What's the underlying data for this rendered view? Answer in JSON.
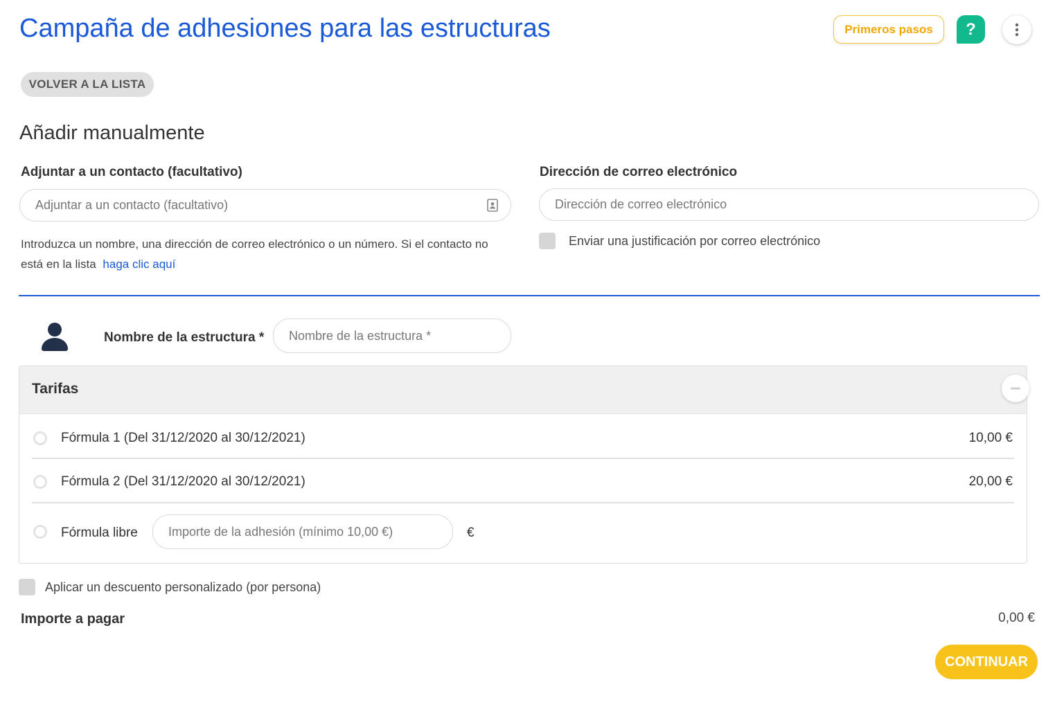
{
  "header": {
    "title": "Campaña de adhesiones para las estructuras",
    "first_steps_label": "Primeros pasos",
    "help_label": "?"
  },
  "back_button_label": "VOLVER A LA LISTA",
  "section_title": "Añadir manualmente",
  "contact": {
    "label": "Adjuntar a un contacto (facultativo)",
    "placeholder": "Adjuntar a un contacto (facultativo)",
    "value": "",
    "helper_text": "Introduzca un nombre, una dirección de correo electrónico o un número. Si el contacto no está en la lista",
    "helper_link": "haga clic aquí"
  },
  "email": {
    "label": "Dirección de correo electrónico",
    "placeholder": "Dirección de correo electrónico",
    "value": "",
    "send_receipt_label": "Enviar una justificación por correo electrónico",
    "send_receipt_checked": false
  },
  "structure": {
    "label": "Nombre de la estructura *",
    "placeholder": "Nombre de la estructura *",
    "value": ""
  },
  "tarifas": {
    "title": "Tarifas",
    "options": [
      {
        "label": "Fórmula 1 (Del 31/12/2020 al 30/12/2021)",
        "price": "10,00 €",
        "selected": false
      },
      {
        "label": "Fórmula 2 (Del 31/12/2020 al 30/12/2021)",
        "price": "20,00 €",
        "selected": false
      }
    ],
    "free": {
      "label": "Fórmula libre",
      "placeholder": "Importe de la adhesión (mínimo 10,00 €)",
      "value": "",
      "currency": "€",
      "selected": false
    }
  },
  "discount": {
    "label": "Aplicar un descuento personalizado (por persona)",
    "checked": false
  },
  "total": {
    "label": "Importe a pagar",
    "value": "0,00 €"
  },
  "continue_label": "CONTINUAR",
  "colors": {
    "primary_blue": "#1a5ad7",
    "accent_yellow": "#f7c21a",
    "help_green": "#11b98c"
  }
}
